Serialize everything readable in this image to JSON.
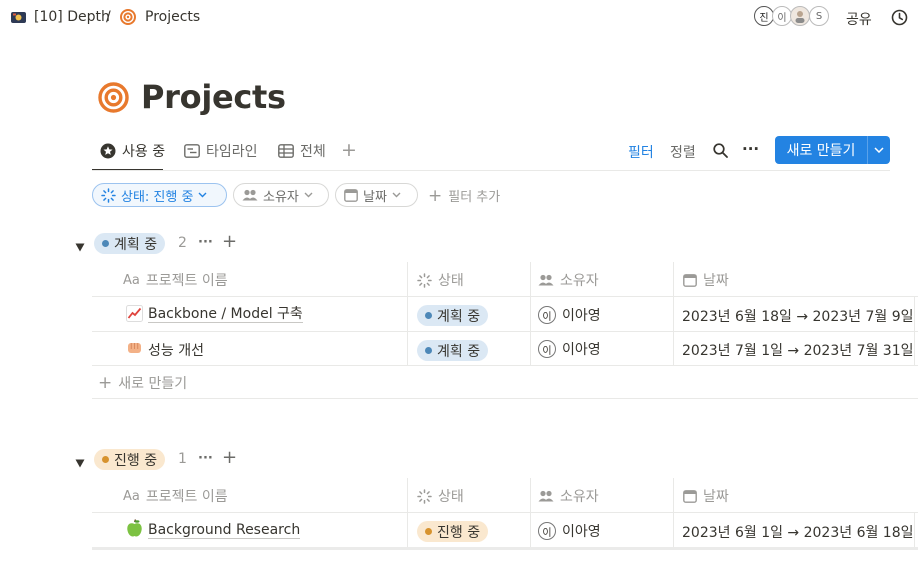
{
  "topbar": {
    "workspace_label": "[10] Depth",
    "separator": "/",
    "page_crumb": "Projects",
    "avatars": [
      "진",
      "이",
      "",
      "S"
    ],
    "share_label": "공유"
  },
  "page": {
    "title": "Projects"
  },
  "views": {
    "tabs": [
      {
        "label": "사용 중"
      },
      {
        "label": "타임라인"
      },
      {
        "label": "전체"
      }
    ],
    "add": "+",
    "filter_label": "필터",
    "sort_label": "정렬",
    "more": "···",
    "new_button_label": "새로 만들기"
  },
  "filters": {
    "status_chip": "상태: 진행 중",
    "owner_chip": "소유자",
    "date_chip": "날짜",
    "add_filter": "필터 추가"
  },
  "columns": {
    "name": "프로젝트 이름",
    "name_prefix": "Aa",
    "status": "상태",
    "owner": "소유자",
    "date": "날짜"
  },
  "groups": [
    {
      "label": "계획 중",
      "count": "2",
      "rows": [
        {
          "icon": "chart-increasing-icon",
          "name": "Backbone / Model 구축",
          "status": "계획 중",
          "owner_initial": "이",
          "owner": "이아영",
          "date": "2023년 6월 18일 → 2023년 7월 9일"
        },
        {
          "icon": "fist-icon",
          "name": "성능 개선",
          "status": "계획 중",
          "owner_initial": "이",
          "owner": "이아영",
          "date": "2023년 7월 1일 → 2023년 7월 31일"
        }
      ],
      "new_row": "새로 만들기"
    },
    {
      "label": "진행 중",
      "count": "1",
      "rows": [
        {
          "icon": "green-apple-icon",
          "name": "Background Research",
          "status": "진행 중",
          "owner_initial": "이",
          "owner": "이아영",
          "date": "2023년 6월 1일 → 2023년 6월 18일"
        }
      ]
    }
  ],
  "colors": {
    "accent": "#2383e2",
    "title_icon": "#e8792d",
    "planned_dot": "#4d88b8",
    "inprogress_dot": "#d7932e"
  }
}
